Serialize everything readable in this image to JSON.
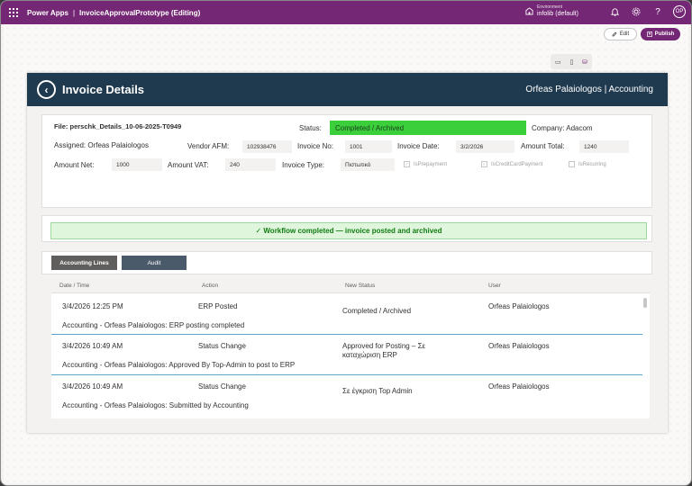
{
  "topbar": {
    "app_name": "Power Apps",
    "separator": "|",
    "title": "InvoiceApprovalPrototype (Editing)",
    "env_label": "Environment",
    "env_value": "infolib (default)",
    "avatar": "OP",
    "help": "?"
  },
  "toolbar": {
    "edit_label": "Edit",
    "publish_label": "Publish"
  },
  "header": {
    "title": "Invoice Details",
    "user_area": "Orfeas Palaiologos | Accounting"
  },
  "details": {
    "file": "File: perschk_Details_10-06-2025-T0949",
    "status_label": "Status:",
    "status_value": "Completed / Archived",
    "company": "Company: Adacom",
    "assigned": "Assigned: Orfeas Palaiologos",
    "vendor_afm_label": "Vendor AFM:",
    "vendor_afm_value": "102938476",
    "invoice_no_label": "Invoice No:",
    "invoice_no_value": "1001",
    "invoice_date_label": "Invoice Date:",
    "invoice_date_value": "3/2/2026",
    "amount_total_label": "Amount Total:",
    "amount_total_value": "1240",
    "amount_net_label": "Amount Net:",
    "amount_net_value": "1000",
    "amount_vat_label": "Amount VAT:",
    "amount_vat_value": "240",
    "invoice_type_label": "Invoice Type:",
    "invoice_type_value": "Πιστωτικό",
    "chk_prepayment": "IsPrepayment",
    "chk_creditcard": "IsCreditCardPayment",
    "chk_recurring": "IsRecurring"
  },
  "banner": {
    "text": "✓ Workflow completed — invoice posted and archived"
  },
  "tabs": {
    "accounting_lines": "Accounting Lines",
    "audit": "Audit"
  },
  "table": {
    "headers": [
      "Date / Time",
      "Action",
      "New Status",
      "User"
    ],
    "rows": [
      {
        "datetime": "3/4/2026 12:25 PM",
        "action": "ERP Posted",
        "status": "Completed / Archived",
        "user": "Orfeas Palaiologos",
        "note": "Accounting - Orfeas Palaiologos: ERP posting completed"
      },
      {
        "datetime": "3/4/2026 10:49 AM",
        "action": "Status Change",
        "status": "Approved for Posting – Σε καταχώριση ERP",
        "user": "Orfeas Palaiologos",
        "note": "Accounting - Orfeas Palaiologos: Approved By Top-Admin to post to ERP"
      },
      {
        "datetime": "3/4/2026 10:49 AM",
        "action": "Status Change",
        "status": "Σε έγκριση Top Admin",
        "user": "Orfeas Palaiologos",
        "note": "Accounting - Orfeas Palaiologos: Submitted by Accounting"
      }
    ]
  },
  "colors": {
    "brand": "#742774",
    "header": "#1f3a4f",
    "status_green": "#3ccf3c",
    "banner_bg": "#dff6dd",
    "banner_text": "#107c10"
  }
}
